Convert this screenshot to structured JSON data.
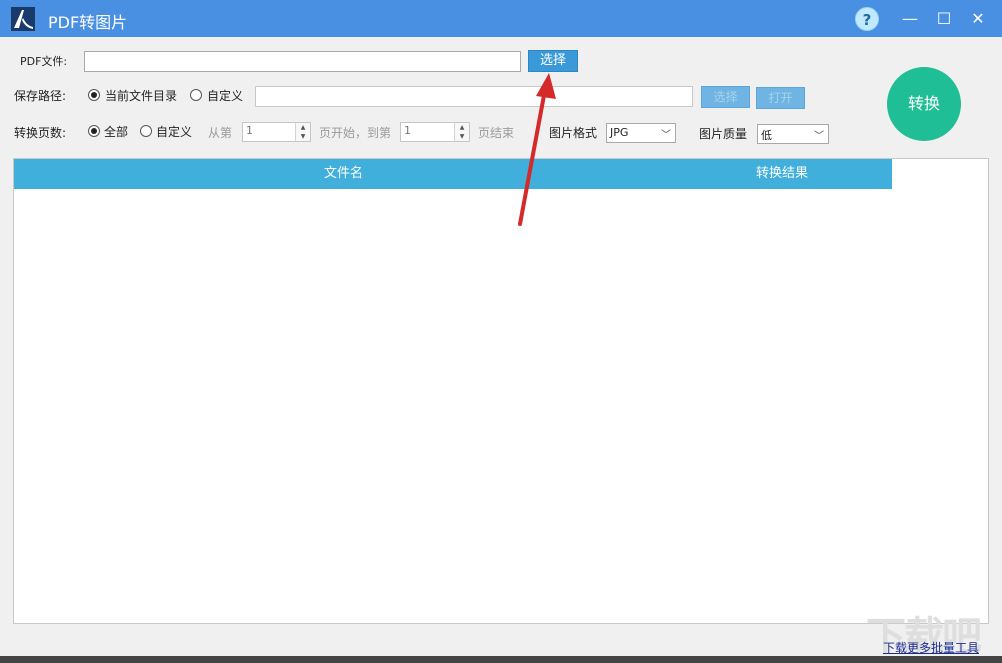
{
  "window": {
    "title": "PDF转图片",
    "help_glyph": "?",
    "minimize_glyph": "—",
    "maximize_glyph": "☐",
    "close_glyph": "✕"
  },
  "pdf_file": {
    "label": "PDF文件:",
    "value": "",
    "select_label": "选择"
  },
  "save_path": {
    "label": "保存路径:",
    "option_current": "当前文件目录",
    "option_custom": "自定义",
    "selected": "当前文件目录",
    "path_value": "",
    "select_label": "选择",
    "open_label": "打开"
  },
  "pages": {
    "label": "转换页数:",
    "option_all": "全部",
    "option_custom": "自定义",
    "selected": "全部",
    "from_label": "从第",
    "from_value": "1",
    "mid_label": "页开始，到第",
    "to_value": "1",
    "end_label": "页结束"
  },
  "format": {
    "label": "图片格式",
    "value": "JPG"
  },
  "quality": {
    "label": "图片质量",
    "value": "低"
  },
  "convert_label": "转换",
  "table": {
    "columns": [
      "文件名",
      "转换结果"
    ],
    "rows": []
  },
  "footer": {
    "link_text": "下载更多批量工具",
    "watermark": "下载吧"
  },
  "colors": {
    "titlebar": "#4a90e2",
    "button": "#3a9ad9",
    "convert": "#1fbe96",
    "table_header": "#41afdc",
    "annotation_arrow": "#d42a2a"
  },
  "icons": {
    "logo": "pdf-app-logo-icon",
    "help": "help-icon",
    "minimize": "minimize-icon",
    "maximize": "maximize-icon",
    "close": "close-icon",
    "annotation": "red-arrow-annotation"
  }
}
